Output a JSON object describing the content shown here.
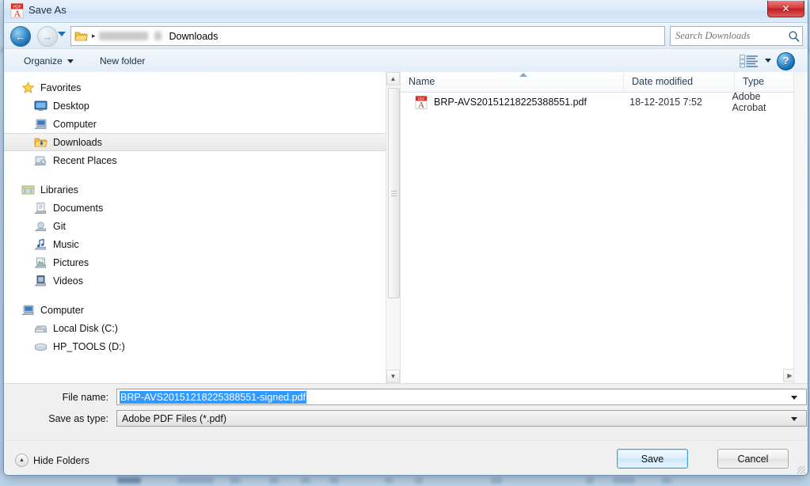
{
  "window": {
    "title": "Save As",
    "title_icon": "adobe-pdf-icon",
    "close_label": "✕"
  },
  "address_bar": {
    "back_icon": "←",
    "forward_icon": "→",
    "recent_pages_icon": "chevron-down-icon",
    "folder_icon": "folder-icon",
    "separator": "▸",
    "current_folder": "Downloads",
    "dropdown_icon": "chevron-down-icon",
    "refresh_icon": "↻"
  },
  "search": {
    "placeholder": "Search Downloads",
    "value": "",
    "icon": "search-icon"
  },
  "command_bar": {
    "organize_label": "Organize",
    "new_folder_label": "New folder",
    "view_icon": "list-view-icon",
    "help_label": "?"
  },
  "navigation": {
    "groups": [
      {
        "header": {
          "label": "Favorites",
          "icon": "star-icon"
        },
        "items": [
          {
            "label": "Desktop",
            "icon": "desktop-icon",
            "selected": false
          },
          {
            "label": "Computer",
            "icon": "computer-icon",
            "selected": false
          },
          {
            "label": "Downloads",
            "icon": "downloads-folder-icon",
            "selected": true
          },
          {
            "label": "Recent Places",
            "icon": "recent-places-icon",
            "selected": false
          }
        ]
      },
      {
        "header": {
          "label": "Libraries",
          "icon": "libraries-icon"
        },
        "items": [
          {
            "label": "Documents",
            "icon": "documents-icon",
            "selected": false
          },
          {
            "label": "Git",
            "icon": "git-library-icon",
            "selected": false
          },
          {
            "label": "Music",
            "icon": "music-icon",
            "selected": false
          },
          {
            "label": "Pictures",
            "icon": "pictures-icon",
            "selected": false
          },
          {
            "label": "Videos",
            "icon": "videos-icon",
            "selected": false
          }
        ]
      },
      {
        "header": {
          "label": "Computer",
          "icon": "computer-icon"
        },
        "items": [
          {
            "label": "Local Disk (C:)",
            "icon": "hard-drive-icon",
            "selected": false
          },
          {
            "label": "HP_TOOLS (D:)",
            "icon": "removable-drive-icon",
            "selected": false
          }
        ]
      }
    ]
  },
  "file_list": {
    "columns": [
      {
        "label": "Name",
        "sorted": "ascending"
      },
      {
        "label": "Date modified",
        "sorted": ""
      },
      {
        "label": "Type",
        "sorted": ""
      }
    ],
    "rows": [
      {
        "icon": "pdf-file-icon",
        "name": "BRP-AVS20151218225388551.pdf",
        "date_modified": "18-12-2015 7:52",
        "type": "Adobe Acrobat"
      }
    ]
  },
  "form": {
    "file_name_label": "File name:",
    "file_name_value": "BRP-AVS20151218225388551-signed.pdf",
    "save_as_type_label": "Save as type:",
    "save_as_type_value": "Adobe PDF Files (*.pdf)"
  },
  "footer": {
    "hide_folders_label": "Hide Folders",
    "hide_folders_icon": "chevron-up-icon",
    "save_label": "Save",
    "cancel_label": "Cancel"
  },
  "background": {
    "obscured_heading": "Overige gegevens"
  },
  "colors": {
    "selection_blue": "#3399ff",
    "default_button_border": "#3c9fdc",
    "close_button_red": "#d63a3a",
    "accent_green": "#2e8b57"
  }
}
